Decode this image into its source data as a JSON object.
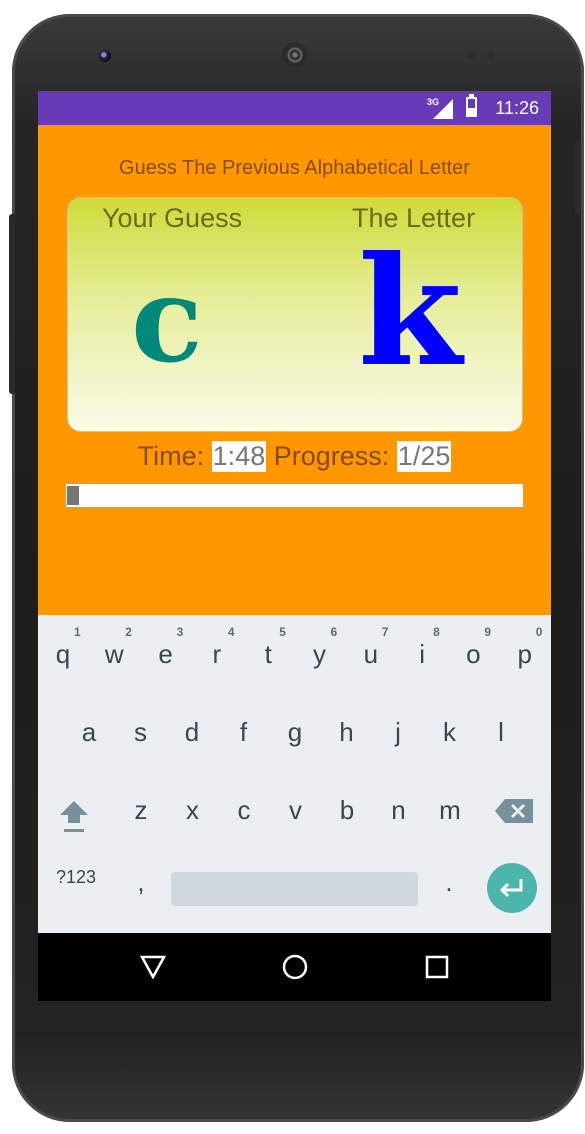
{
  "status": {
    "network": "3G",
    "time": "11:26"
  },
  "app": {
    "subtitle": "Guess The Previous Alphabetical Letter",
    "guess_label": "Your Guess",
    "letter_label": "The Letter",
    "guess_letter": "c",
    "target_letter": "k",
    "time_label": "Time:",
    "time_value": "1:48",
    "progress_label": "Progress:",
    "progress_value": "1/25",
    "progress_fraction": 0.04
  },
  "keyboard": {
    "row1": [
      {
        "key": "q",
        "hint": "1"
      },
      {
        "key": "w",
        "hint": "2"
      },
      {
        "key": "e",
        "hint": "3"
      },
      {
        "key": "r",
        "hint": "4"
      },
      {
        "key": "t",
        "hint": "5"
      },
      {
        "key": "y",
        "hint": "6"
      },
      {
        "key": "u",
        "hint": "7"
      },
      {
        "key": "i",
        "hint": "8"
      },
      {
        "key": "o",
        "hint": "9"
      },
      {
        "key": "p",
        "hint": "0"
      }
    ],
    "row2": [
      "a",
      "s",
      "d",
      "f",
      "g",
      "h",
      "j",
      "k",
      "l"
    ],
    "row3": [
      "z",
      "x",
      "c",
      "v",
      "b",
      "n",
      "m"
    ],
    "symbols": "?123",
    "comma": ",",
    "period": ".",
    "icons": {
      "shift": "shift-icon",
      "backspace": "backspace-icon",
      "enter": "enter-icon"
    }
  },
  "colors": {
    "status_bar": "#673ab7",
    "app_background": "#ff9800",
    "guess_letter": "#00897b",
    "target_letter": "#0000ff",
    "enter_key": "#4db6ac"
  }
}
